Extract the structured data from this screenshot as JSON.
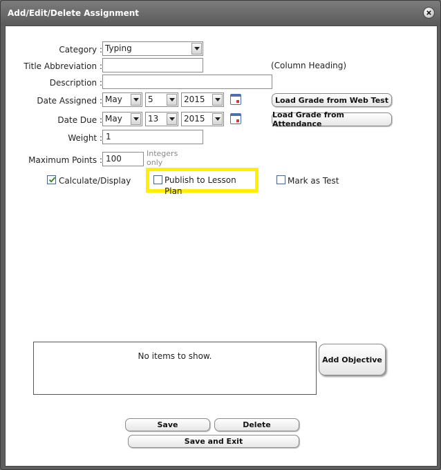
{
  "window": {
    "title": "Add/Edit/Delete Assignment"
  },
  "form": {
    "category_label": "Category :",
    "category_value": "Typing",
    "title_abbrev_label": "Title Abbreviation :",
    "title_abbrev_value": "",
    "column_heading_note": "(Column Heading)",
    "description_label": "Description :",
    "description_value": "",
    "date_assigned_label": "Date Assigned :",
    "date_assigned": {
      "month": "May",
      "day": "5",
      "year": "2015"
    },
    "date_due_label": "Date Due :",
    "date_due": {
      "month": "May",
      "day": "13",
      "year": "2015"
    },
    "weight_label": "Weight :",
    "weight_value": "1",
    "max_points_label": "Maximum Points :",
    "max_points_value": "100",
    "max_points_hint_line1": "Integers",
    "max_points_hint_line2": "only"
  },
  "buttons": {
    "load_web_test": "Load Grade from Web Test",
    "load_attendance": "Load Grade from Attendance",
    "add_objective": "Add Objective",
    "save": "Save",
    "delete": "Delete",
    "save_exit": "Save and Exit"
  },
  "checkboxes": {
    "calculate_display": {
      "label": "Calculate/Display",
      "checked": true
    },
    "publish_lesson_plan": {
      "label": "Publish to Lesson Plan",
      "checked": false
    },
    "mark_as_test": {
      "label": "Mark as Test",
      "checked": false
    }
  },
  "objectives": {
    "empty_text": "No items to show."
  },
  "colors": {
    "highlight": "#ffef00",
    "title_bar": "#6a6a6a",
    "check_mark": "#3a8a2a"
  }
}
